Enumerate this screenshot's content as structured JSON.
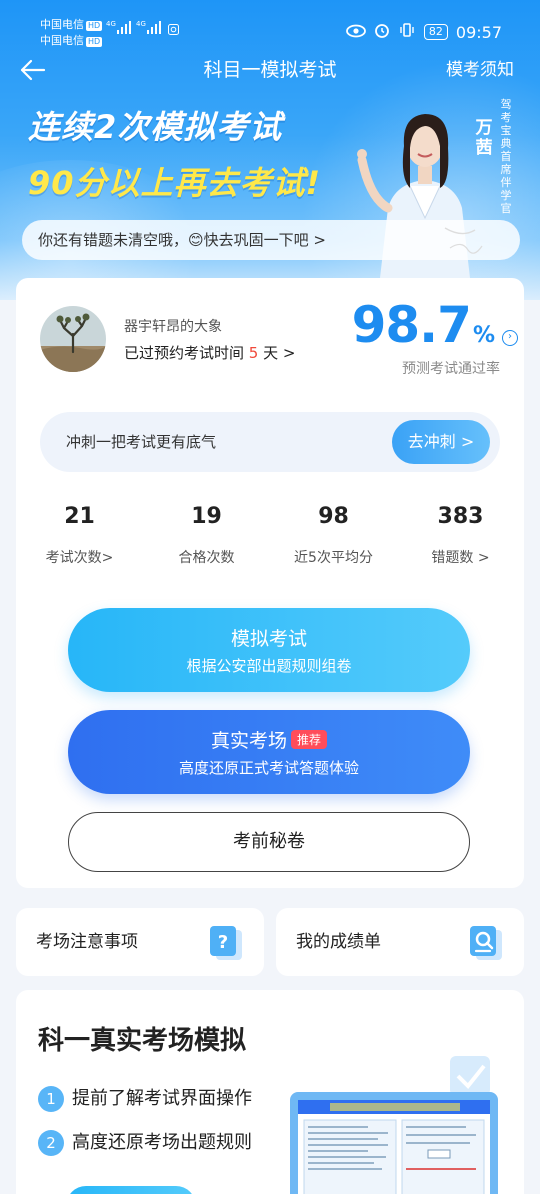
{
  "status_bar": {
    "carrier1": "中国电信",
    "carrier2": "中国电信",
    "hd": "HD",
    "signal": "4G",
    "battery": "82",
    "time": "09:57"
  },
  "nav": {
    "title": "科目一模拟考试",
    "notice": "模考须知"
  },
  "banner": {
    "line1": "连续2次模拟考试",
    "line2": "90分以上再去考试!",
    "spokesperson_name": "万茜",
    "spokesperson_title": "驾考宝典首席伴学官"
  },
  "tip": {
    "text": "你还有错题未清空哦，😊快去巩固一下吧 >"
  },
  "user": {
    "name": "器宇轩昂的大象",
    "count_prefix": "已过预约考试时间 ",
    "count_days": "5",
    "count_suffix": " 天 >"
  },
  "pass_rate": {
    "value": "98.7",
    "unit": "%",
    "label": "预测考试通过率"
  },
  "sprint": {
    "text": "冲刺一把考试更有底气",
    "button": "去冲刺 >"
  },
  "stats": [
    {
      "num": "21",
      "label": "考试次数>"
    },
    {
      "num": "19",
      "label": "合格次数"
    },
    {
      "num": "98",
      "label": "近5次平均分"
    },
    {
      "num": "383",
      "label": "错题数 >"
    }
  ],
  "buttons": {
    "mock_title": "模拟考试",
    "mock_sub": "根据公安部出题规则组卷",
    "real_title": "真实考场",
    "real_badge": "推荐",
    "real_sub": "高度还原正式考试答题体验",
    "secret": "考前秘卷"
  },
  "cards": {
    "notes": "考场注意事项",
    "scores": "我的成绩单"
  },
  "simulation": {
    "title": "科一真实考场模拟",
    "items": [
      {
        "n": "1",
        "text": "提前了解考试界面操作"
      },
      {
        "n": "2",
        "text": "高度还原考场出题规则"
      }
    ]
  },
  "colors": {
    "primary": "#1d8cf0",
    "hero_top": "#1e95f7",
    "accent_yellow": "#ffe84a",
    "highlight_red": "#f0493a",
    "badge_red": "#ff4d5a"
  }
}
